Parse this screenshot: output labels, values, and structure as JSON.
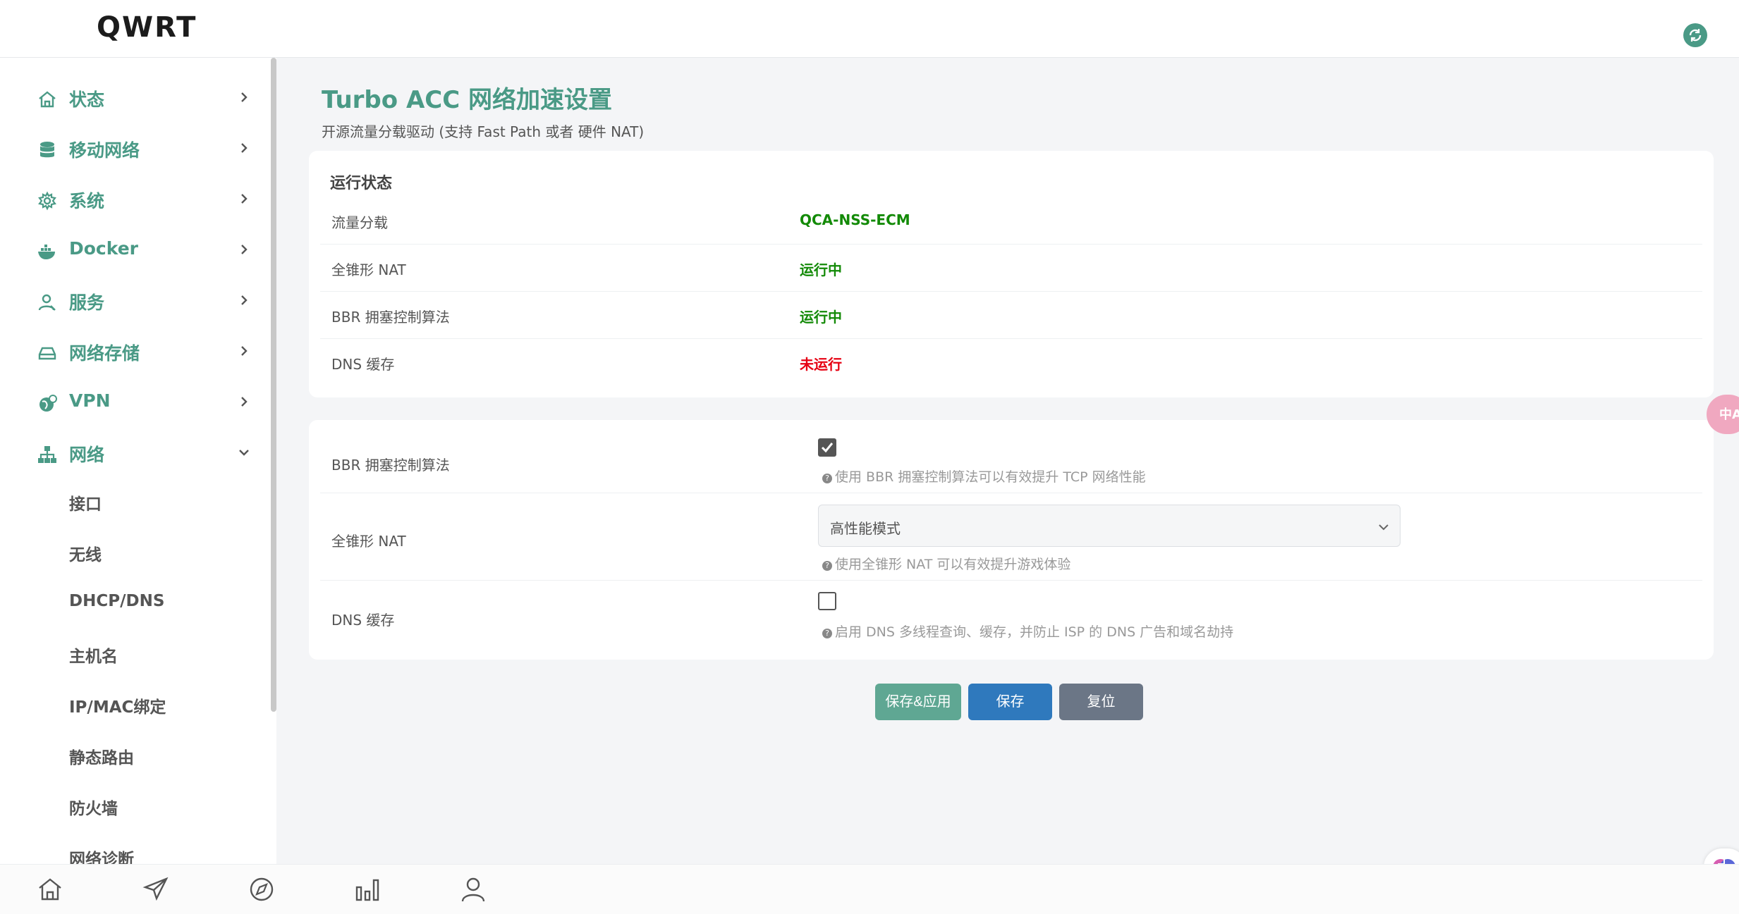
{
  "app": {
    "logo": "QWRT"
  },
  "sidebar": {
    "items": [
      {
        "label": "状态",
        "icon": "home-icon",
        "expanded": false
      },
      {
        "label": "移动网络",
        "icon": "database-icon",
        "expanded": false
      },
      {
        "label": "系统",
        "icon": "gear-icon",
        "expanded": false
      },
      {
        "label": "Docker",
        "icon": "docker-icon",
        "expanded": false
      },
      {
        "label": "服务",
        "icon": "user-icon",
        "expanded": false
      },
      {
        "label": "网络存储",
        "icon": "drive-icon",
        "expanded": false
      },
      {
        "label": "VPN",
        "icon": "globe-icon",
        "expanded": false
      },
      {
        "label": "网络",
        "icon": "network-icon",
        "expanded": true
      }
    ],
    "sub_items": [
      "接口",
      "无线",
      "DHCP/DNS",
      "主机名",
      "IP/MAC绑定",
      "静态路由",
      "防火墙",
      "网络诊断"
    ]
  },
  "page": {
    "title": "Turbo ACC 网络加速设置",
    "description": "开源流量分载驱动 (支持 Fast Path 或者 硬件 NAT)"
  },
  "status": {
    "section_title": "运行状态",
    "rows": [
      {
        "label": "流量分载",
        "value": "QCA-NSS-ECM",
        "color": "#138a07"
      },
      {
        "label": "全锥形 NAT",
        "value": "运行中",
        "color": "#138a07"
      },
      {
        "label": "BBR 拥塞控制算法",
        "value": "运行中",
        "color": "#138a07"
      },
      {
        "label": "DNS 缓存",
        "value": "未运行",
        "color": "#e60012"
      }
    ]
  },
  "options": {
    "bbr": {
      "label": "BBR 拥塞控制算法",
      "checked": true,
      "help": "使用 BBR 拥塞控制算法可以有效提升 TCP 网络性能"
    },
    "fullcone": {
      "label": "全锥形 NAT",
      "selected": "高性能模式",
      "help": "使用全锥形 NAT 可以有效提升游戏体验"
    },
    "dns": {
      "label": "DNS 缓存",
      "checked": false,
      "help": "启用 DNS 多线程查询、缓存，并防止 ISP 的 DNS 广告和域名劫持"
    }
  },
  "buttons": {
    "apply": "保存&应用",
    "save": "保存",
    "reset": "复位"
  },
  "floats": {
    "translate": "中A"
  },
  "bottom_bar": {
    "icons": [
      "home-icon",
      "send-icon",
      "compass-icon",
      "bar-chart-icon",
      "user-icon"
    ]
  },
  "colors": {
    "accent": "#4a9a86",
    "running": "#138a07",
    "stopped": "#e60012"
  }
}
